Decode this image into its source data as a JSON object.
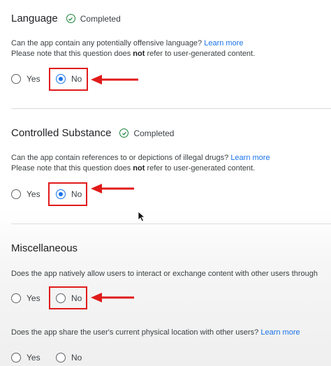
{
  "language": {
    "title": "Language",
    "status": "Completed",
    "question": "Can the app contain any potentially offensive language?",
    "learn_more": "Learn more",
    "note_pre": "Please note that this question does ",
    "note_bold": "not",
    "note_post": " refer to user-generated content.",
    "yes_label": "Yes",
    "no_label": "No",
    "selected": "No"
  },
  "controlled": {
    "title": "Controlled Substance",
    "status": "Completed",
    "question": "Can the app contain references to or depictions of illegal drugs?",
    "learn_more": "Learn more",
    "note_pre": "Please note that this question does ",
    "note_bold": "not",
    "note_post": " refer to user-generated content.",
    "yes_label": "Yes",
    "no_label": "No",
    "selected": "No"
  },
  "misc": {
    "title": "Miscellaneous",
    "q1": "Does the app natively allow users to interact or exchange content with other users through",
    "q1_yes": "Yes",
    "q1_no": "No",
    "q2": "Does the app share the user's current physical location with other users?",
    "q2_learn_more": "Learn more",
    "q2_yes": "Yes",
    "q2_no": "No"
  },
  "colors": {
    "accent": "#1a73e8",
    "completed_green": "#188038",
    "annotation_red": "#e01b1b"
  }
}
